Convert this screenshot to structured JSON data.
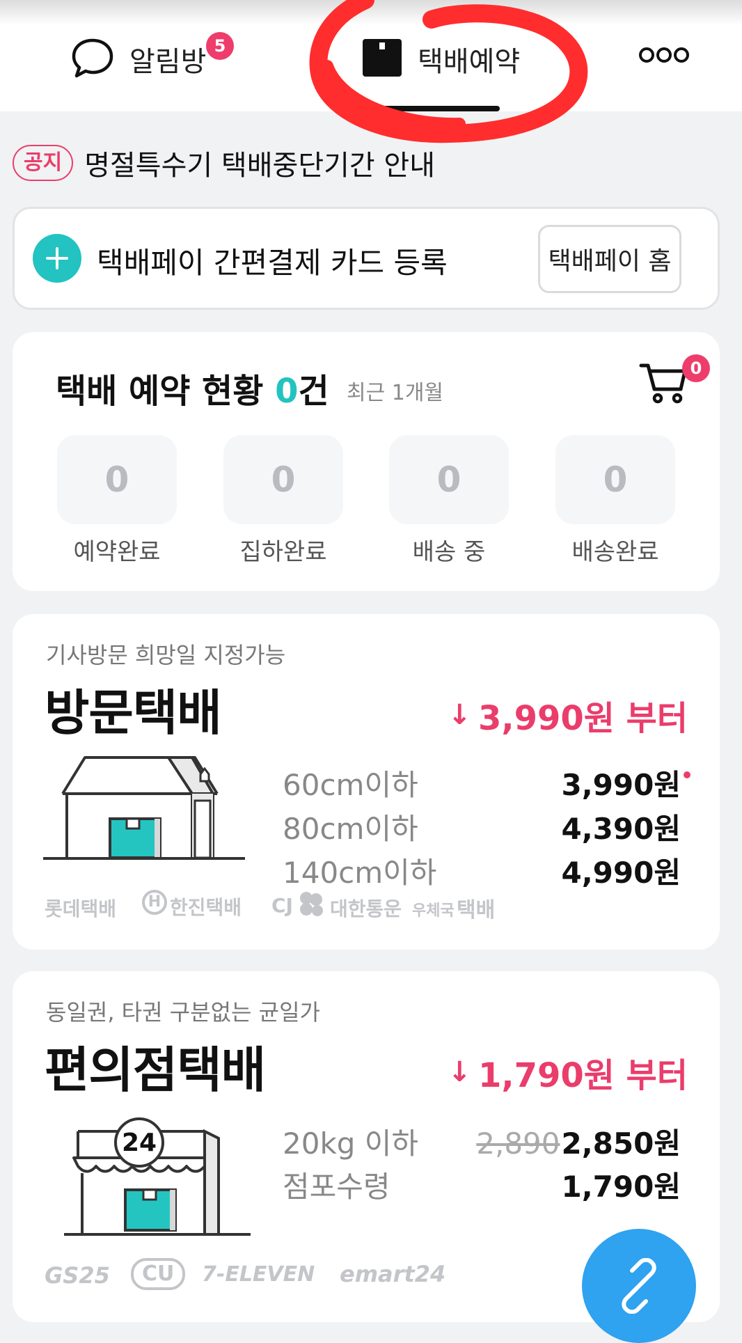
{
  "tabs": {
    "chat": {
      "label": "알림방",
      "badge": "5"
    },
    "parcel": {
      "label": "택배예약"
    }
  },
  "notice": {
    "tag": "공지",
    "text": "명절특수기 택배중단기간 안내"
  },
  "pay": {
    "register_label": "택배페이 간편결제 카드 등록",
    "home_button": "택배페이 홈"
  },
  "status": {
    "title": "택배 예약 현황 ",
    "count": "0",
    "unit": "건",
    "period": "최근 1개월",
    "cart_badge": "0",
    "items": [
      {
        "value": "0",
        "label": "예약완료"
      },
      {
        "value": "0",
        "label": "집하완료"
      },
      {
        "value": "0",
        "label": "배송 중"
      },
      {
        "value": "0",
        "label": "배송완료"
      }
    ]
  },
  "visit": {
    "subtitle": "기사방문 희망일 지정가능",
    "title": "방문택배",
    "from_price": "3,990원 부터",
    "rows": [
      {
        "label": "60cm이하",
        "price": "3,990원"
      },
      {
        "label": "80cm이하",
        "price": "4,390원"
      },
      {
        "label": "140cm이하",
        "price": "4,990원"
      }
    ],
    "carriers": [
      "롯데택배",
      "한진택배",
      "CJ",
      "대한통운",
      "우체국",
      "택배"
    ]
  },
  "cvs": {
    "subtitle": "동일권, 타권 구분없는 균일가",
    "title": "편의점택배",
    "from_price": "1,790원 부터",
    "store_sign": "24",
    "rows": [
      {
        "label": "20kg 이하",
        "old_price": "2,890",
        "price": "2,850원"
      },
      {
        "label": "점포수령",
        "price": "1,790원"
      }
    ],
    "stores": [
      "GS25",
      "CU",
      "7-ELEVEN",
      "emart24"
    ]
  },
  "colors": {
    "accent_pink": "#ea3d6b",
    "accent_teal": "#22c3c0",
    "fab_blue": "#2fa2f0",
    "annotation_red": "#ff2d2d"
  },
  "icons": [
    "chat-bubble-icon",
    "box-icon",
    "more-icon",
    "plus-icon",
    "cart-icon",
    "arrow-down-icon",
    "link-icon"
  ]
}
